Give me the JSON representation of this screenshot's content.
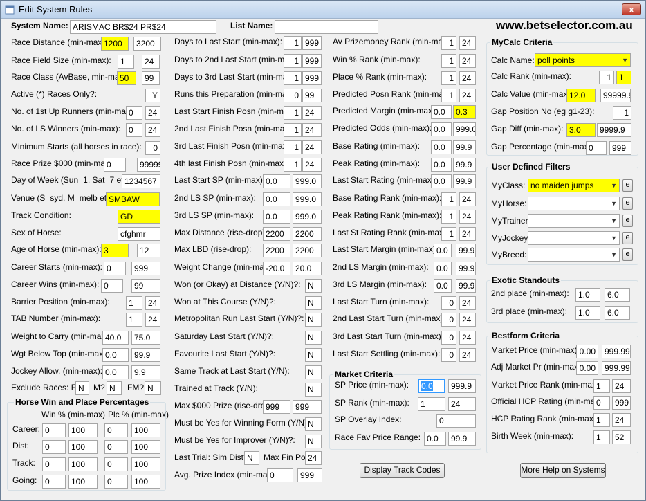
{
  "window": {
    "title": "Edit System Rules",
    "close": "x"
  },
  "header": {
    "system_name_label": "System Name:",
    "system_name": "ARISMAC BR$24 PR$24",
    "list_name_label": "List Name:",
    "list_name": "",
    "url": "www.betselector.com.au"
  },
  "col1": [
    {
      "label": "Race Distance (min-max):",
      "v1": "1200",
      "v2": "3200"
    },
    {
      "label": "Race Field Size (min-max):",
      "v1": "1",
      "v2": "24"
    },
    {
      "label": "Race Class (AvBase, min-max):",
      "v1": "50",
      "v2": "99"
    },
    {
      "label": "Active (*) Races Only?:",
      "v1": "Y"
    },
    {
      "label": "No. of 1st Up Runners (min-max):",
      "v1": "0",
      "v2": "24"
    },
    {
      "label": "No. of LS Winners (min-max):",
      "v1": "0",
      "v2": "24"
    },
    {
      "label": "Minimum Starts (all horses in race):",
      "v1": "0"
    },
    {
      "label": "Race Prize $000 (min-max):",
      "v1": "0",
      "v2": "999999"
    },
    {
      "label": "Day of Week (Sun=1, Sat=7 etc):",
      "v1": "1234567"
    },
    {
      "label": "Venue (S=syd, M=melb etc):",
      "v1": "SMBAW"
    },
    {
      "label": "Track Condition:",
      "v1": "GD"
    },
    {
      "label": "Sex of Horse:",
      "v1": "cfghmr"
    },
    {
      "label": "Age of Horse (min-max):",
      "v1": "3",
      "v2": "12"
    },
    {
      "label": "Career Starts (min-max):",
      "v1": "0",
      "v2": "999"
    },
    {
      "label": "Career Wins (min-max):",
      "v1": "0",
      "v2": "99"
    },
    {
      "label": "Barrier Position (min-max):",
      "v1": "1",
      "v2": "24"
    },
    {
      "label": "TAB Number (min-max):",
      "v1": "1",
      "v2": "24"
    },
    {
      "label": "Weight to Carry (min-max):",
      "v1": "40.0",
      "v2": "75.0"
    },
    {
      "label": "Wgt Below Top (min-max):",
      "v1": "0.0",
      "v2": "99.9"
    },
    {
      "label": "Jockey Allow. (min-max):",
      "v1": "0.0",
      "v2": "9.9"
    }
  ],
  "exclude": {
    "label": "Exclude Races: F?",
    "f": "N",
    "m_label": "M?",
    "m": "N",
    "fm_label": "FM?",
    "fm": "N"
  },
  "horse_pct": {
    "title": "Horse Win and Place Percentages",
    "win_hdr": "Win % (min-max)",
    "plc_hdr": "Plc % (min-max)",
    "rows": [
      {
        "label": "Career:",
        "w1": "0",
        "w2": "100",
        "p1": "0",
        "p2": "100"
      },
      {
        "label": "Dist:",
        "w1": "0",
        "w2": "100",
        "p1": "0",
        "p2": "100"
      },
      {
        "label": "Track:",
        "w1": "0",
        "w2": "100",
        "p1": "0",
        "p2": "100"
      },
      {
        "label": "Going:",
        "w1": "0",
        "w2": "100",
        "p1": "0",
        "p2": "100"
      }
    ]
  },
  "col2": [
    {
      "label": "Days to Last Start (min-max):",
      "v1": "1",
      "v2": "999"
    },
    {
      "label": "Days to 2nd Last Start (min-max):",
      "v1": "1",
      "v2": "999"
    },
    {
      "label": "Days to 3rd Last Start (min-max):",
      "v1": "1",
      "v2": "999"
    },
    {
      "label": "Runs this Preparation (min-max):",
      "v1": "0",
      "v2": "99"
    },
    {
      "label": "Last Start Finish Posn (min-max):",
      "v1": "1",
      "v2": "24"
    },
    {
      "label": "2nd Last Finish Posn (min-max):",
      "v1": "1",
      "v2": "24"
    },
    {
      "label": "3rd Last Finish Posn (min-max):",
      "v1": "1",
      "v2": "24"
    },
    {
      "label": "4th last Finish Posn (min-max):",
      "v1": "1",
      "v2": "24"
    },
    {
      "label": "Last Start SP (min-max):",
      "v1": "0.0",
      "v2": "999.0"
    },
    {
      "label": "2nd LS SP (min-max):",
      "v1": "0.0",
      "v2": "999.0"
    },
    {
      "label": "3rd LS SP (min-max):",
      "v1": "0.0",
      "v2": "999.0"
    },
    {
      "label": "Max Distance (rise-drop):",
      "v1": "2200",
      "v2": "2200"
    },
    {
      "label": "Max LBD (rise-drop):",
      "v1": "2200",
      "v2": "2200"
    },
    {
      "label": "Weight Change (min-max):",
      "v1": "-20.0",
      "v2": "20.0"
    },
    {
      "label": "Won (or Okay) at Distance (Y/N)?:",
      "v1": "N"
    },
    {
      "label": "Won at This Course (Y/N)?:",
      "v1": "N"
    },
    {
      "label": "Metropolitan Run Last Start (Y/N)?:",
      "v1": "N"
    },
    {
      "label": "Saturday Last Start (Y/N)?:",
      "v1": "N"
    },
    {
      "label": "Favourite Last Start (Y/N)?:",
      "v1": "N"
    },
    {
      "label": "Same Track at Last Start (Y/N):",
      "v1": "N"
    },
    {
      "label": "Trained at Track (Y/N):",
      "v1": "N"
    },
    {
      "label": "Max $000 Prize (rise-drop):",
      "v1": "999",
      "v2": "999"
    },
    {
      "label": "Must be Yes for Winning Form (Y/N)?:",
      "v1": "N"
    },
    {
      "label": "Must be Yes for Improver (Y/N)?:",
      "v1": "N"
    }
  ],
  "last_trial": {
    "label": "Last Trial:  Sim Dist?",
    "v1": "N",
    "fin_label": "Max Fin Pos",
    "v2": "24"
  },
  "avg_prize": {
    "label": "Avg. Prize Index (min-max):",
    "v1": "0",
    "v2": "999"
  },
  "col3": [
    {
      "label": "Av Prizemoney Rank (min-max):",
      "v1": "1",
      "v2": "24"
    },
    {
      "label": "Win % Rank (min-max):",
      "v1": "1",
      "v2": "24"
    },
    {
      "label": "Place % Rank (min-max):",
      "v1": "1",
      "v2": "24"
    },
    {
      "label": "Predicted Posn Rank (min-max):",
      "v1": "1",
      "v2": "24"
    },
    {
      "label": "Predicted Margin (min-max):",
      "v1": "0.0",
      "v2": "0.3"
    },
    {
      "label": "Predicted Odds (min-max):",
      "v1": "0.0",
      "v2": "999.0"
    },
    {
      "label": "Base Rating (min-max):",
      "v1": "0.0",
      "v2": "99.9"
    },
    {
      "label": "Peak Rating (min-max):",
      "v1": "0.0",
      "v2": "99.9"
    },
    {
      "label": "Last Start Rating (min-max):",
      "v1": "0.0",
      "v2": "99.9"
    },
    {
      "label": "Base Rating Rank (min-max):",
      "v1": "1",
      "v2": "24"
    },
    {
      "label": "Peak Rating Rank (min-max):",
      "v1": "1",
      "v2": "24"
    },
    {
      "label": "Last St Rating Rank (min-max):",
      "v1": "1",
      "v2": "24"
    },
    {
      "label": "Last Start Margin (min-max):",
      "v1": "0.0",
      "v2": "99.9"
    },
    {
      "label": "2nd LS Margin (min-max):",
      "v1": "0.0",
      "v2": "99.9"
    },
    {
      "label": "3rd LS Margin (min-max):",
      "v1": "0.0",
      "v2": "99.9"
    },
    {
      "label": "Last Start Turn (min-max):",
      "v1": "0",
      "v2": "24"
    },
    {
      "label": "2nd Last Start Turn (min-max):",
      "v1": "0",
      "v2": "24"
    },
    {
      "label": "3rd Last Start Turn (min-max):",
      "v1": "0",
      "v2": "24"
    },
    {
      "label": "Last Start Settling (min-max):",
      "v1": "0",
      "v2": "24"
    }
  ],
  "market": {
    "title": "Market Criteria",
    "rows": [
      {
        "label": "SP Price (min-max):",
        "v1": "0.0",
        "v2": "999.9"
      },
      {
        "label": "SP Rank (min-max):",
        "v1": "1",
        "v2": "24"
      },
      {
        "label": "SP Overlay Index:",
        "v1": "0"
      },
      {
        "label": "Race Fav Price Range:",
        "v1": "0.0",
        "v2": "99.9"
      }
    ]
  },
  "mycalc": {
    "title": "MyCalc Criteria",
    "calc_name_label": "Calc Name:",
    "calc_name": "poll points",
    "rows": [
      {
        "label": "Calc Rank (min-max):",
        "v1": "1",
        "v2": "1"
      },
      {
        "label": "Calc Value (min-max):",
        "v1": "12.0",
        "v2": "99999.9"
      },
      {
        "label": "Gap Position No (eg g1-23):",
        "v1": "1"
      },
      {
        "label": "Gap Diff (min-max):",
        "v1": "3.0",
        "v2": "9999.9"
      },
      {
        "label": "Gap Percentage (min-max):",
        "v1": "0",
        "v2": "999"
      }
    ]
  },
  "udf": {
    "title": "User Defined Filters",
    "e": "e",
    "rows": [
      {
        "label": "MyClass:",
        "value": "no maiden jumps"
      },
      {
        "label": "MyHorse:",
        "value": ""
      },
      {
        "label": "MyTrainer:",
        "value": ""
      },
      {
        "label": "MyJockey:",
        "value": ""
      },
      {
        "label": "MyBreed:",
        "value": ""
      }
    ]
  },
  "exotic": {
    "title": "Exotic Standouts",
    "rows": [
      {
        "label": "2nd place (min-max):",
        "v1": "1.0",
        "v2": "6.0"
      },
      {
        "label": "3rd place (min-max):",
        "v1": "1.0",
        "v2": "6.0"
      }
    ]
  },
  "bestform": {
    "title": "Bestform Criteria",
    "rows": [
      {
        "label": "Market Price (min-max):",
        "v1": "0.00",
        "v2": "999.99"
      },
      {
        "label": "Adj Market Pr (min-max):",
        "v1": "0.00",
        "v2": "999.99"
      },
      {
        "label": "Market Price Rank (min-max):",
        "v1": "1",
        "v2": "24"
      },
      {
        "label": "Official HCP Rating (min-max):",
        "v1": "0",
        "v2": "999"
      },
      {
        "label": "HCP Rating Rank (min-max):",
        "v1": "1",
        "v2": "24"
      },
      {
        "label": "Birth Week (min-max):",
        "v1": "1",
        "v2": "52"
      }
    ]
  },
  "buttons": {
    "display_track_codes": "Display Track Codes",
    "more_help": "More Help on Systems"
  },
  "highlight_color": "#ffff00"
}
